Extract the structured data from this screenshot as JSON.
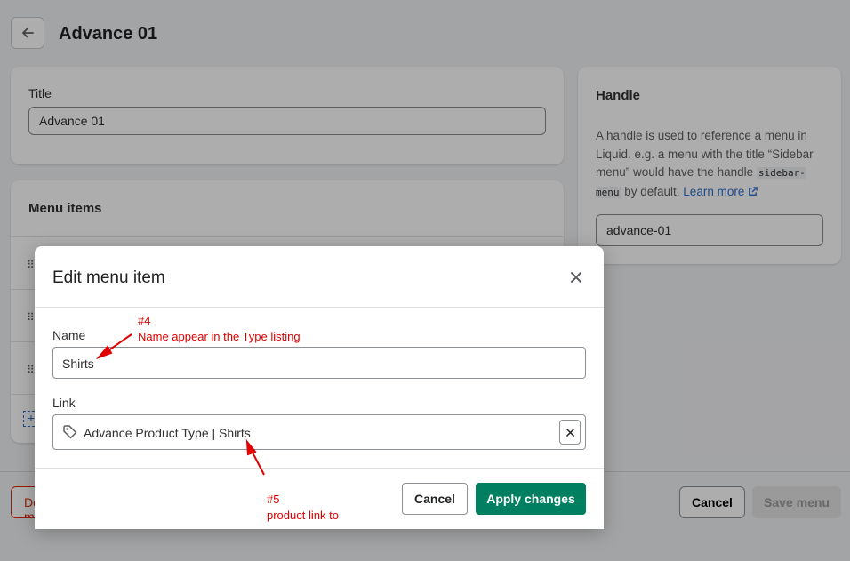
{
  "header": {
    "title": "Advance 01",
    "back_icon": "arrow-left-icon"
  },
  "title_card": {
    "label": "Title",
    "value": "Advance 01"
  },
  "menu_card": {
    "heading": "Menu items"
  },
  "handle_card": {
    "heading": "Handle",
    "desc_part1": "A handle is used to reference a menu in Liquid. e.g. a menu with the title “Sidebar menu” would have the handle ",
    "code": "sidebar-menu",
    "desc_part2": " by default. ",
    "learn_more": "Learn more",
    "value": "advance-01"
  },
  "footer": {
    "delete_label": "Delete menu",
    "cancel_label": "Cancel",
    "save_label": "Save menu"
  },
  "modal": {
    "title": "Edit menu item",
    "name_label": "Name",
    "name_value": "Shirts",
    "link_label": "Link",
    "link_value": "Advance Product Type | Shirts",
    "cancel_label": "Cancel",
    "apply_label": "Apply changes"
  },
  "annotations": {
    "a4_num": "#4",
    "a4_text": "Name appear in the Type listing",
    "a5_num": "#5",
    "a5_text": "product link to"
  },
  "colors": {
    "primary": "#008060",
    "annotation": "#e00000",
    "link": "#2c6ecb",
    "critical": "#d72c0d"
  }
}
